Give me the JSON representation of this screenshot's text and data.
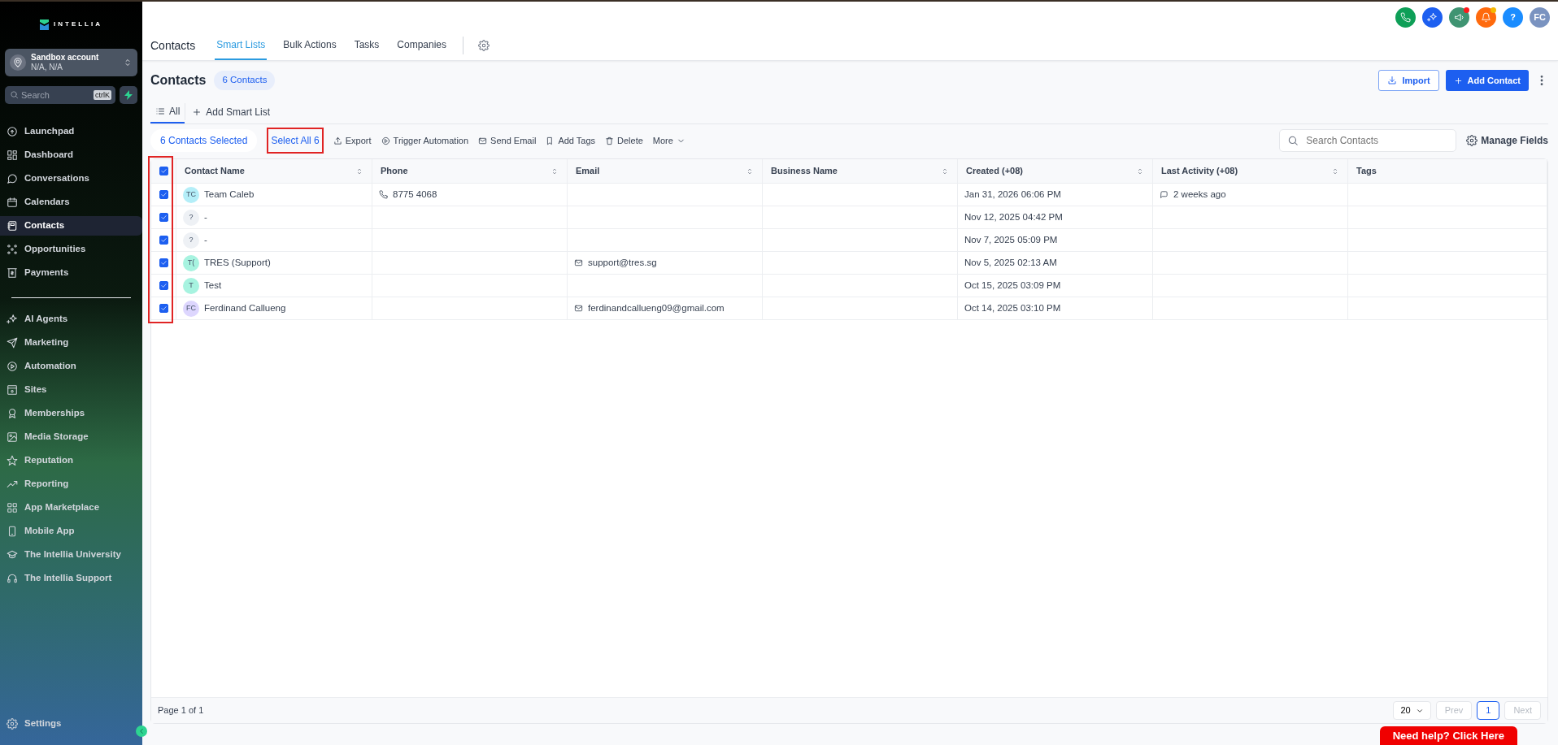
{
  "sidebar": {
    "logo": "INTELLIA",
    "account": {
      "name": "Sandbox account",
      "location": "N/A, N/A"
    },
    "search": {
      "placeholder": "Search",
      "shortcut": "ctrlK"
    },
    "main_items": [
      {
        "label": "Launchpad",
        "selected": false
      },
      {
        "label": "Dashboard",
        "selected": false
      },
      {
        "label": "Conversations",
        "selected": false
      },
      {
        "label": "Calendars",
        "selected": false
      },
      {
        "label": "Contacts",
        "selected": true
      },
      {
        "label": "Opportunities",
        "selected": false
      },
      {
        "label": "Payments",
        "selected": false
      }
    ],
    "more_items": [
      {
        "label": "AI Agents",
        "selected": false
      },
      {
        "label": "Marketing",
        "selected": false
      },
      {
        "label": "Automation",
        "selected": false
      },
      {
        "label": "Sites",
        "selected": false
      },
      {
        "label": "Memberships",
        "selected": false
      },
      {
        "label": "Media Storage",
        "selected": false
      },
      {
        "label": "Reputation",
        "selected": false
      },
      {
        "label": "Reporting",
        "selected": false
      },
      {
        "label": "App Marketplace",
        "selected": false
      },
      {
        "label": "Mobile App",
        "selected": false
      },
      {
        "label": "The Intellia University",
        "selected": false
      },
      {
        "label": "The Intellia Support",
        "selected": false
      }
    ],
    "settings": "Settings"
  },
  "header": {
    "title": "Contacts",
    "tabs": [
      {
        "label": "Smart Lists",
        "selected": true
      },
      {
        "label": "Bulk Actions",
        "selected": false
      },
      {
        "label": "Tasks",
        "selected": false
      },
      {
        "label": "Companies",
        "selected": false
      }
    ],
    "quick_actions": [
      {
        "kind": "phone",
        "color": "#0e9f57",
        "alert": false
      },
      {
        "kind": "sparkle",
        "color": "#1d5ff0",
        "alert": false
      },
      {
        "kind": "megaphone",
        "color": "#3f9472",
        "alert": true
      },
      {
        "kind": "bell",
        "color": "#ff6a0d",
        "alert": true
      },
      {
        "kind": "help",
        "color": "#1a8cff",
        "alert": false,
        "label": "?"
      },
      {
        "kind": "avatar",
        "color": "#7a93c0",
        "alert": false,
        "label": "FC"
      }
    ]
  },
  "page": {
    "title": "Contacts",
    "count": "6 Contacts",
    "import": "Import",
    "add": "Add Contact",
    "list_tabs": [
      {
        "label": "All",
        "selected": true
      }
    ],
    "add_list": "Add Smart List"
  },
  "bulk": {
    "selected_count": "6 Contacts Selected",
    "select_all": {
      "label": "Select All 6",
      "highlighted": true
    },
    "actions": [
      "Export",
      "Trigger Automation",
      "Send Email",
      "Add Tags",
      "Delete"
    ],
    "more": "More",
    "search": {
      "placeholder": "Search Contacts"
    },
    "manage_fields": "Manage Fields"
  },
  "table": {
    "all_checked": true,
    "checkbox_column_highlighted": true,
    "columns": [
      {
        "label": "Contact Name",
        "sortable": true
      },
      {
        "label": "Phone",
        "sortable": true
      },
      {
        "label": "Email",
        "sortable": true
      },
      {
        "label": "Business Name",
        "sortable": true
      },
      {
        "label": "Created (+08)",
        "sortable": true
      },
      {
        "label": "Last Activity (+08)",
        "sortable": true
      },
      {
        "label": "Tags",
        "sortable": false
      }
    ],
    "rows": [
      {
        "checked": true,
        "initials": "TC",
        "color": "#b4eef8",
        "name": "Team Caleb",
        "phone": "8775 4068",
        "created": "Jan 31, 2026 06:06 PM",
        "last_activity": "2 weeks ago"
      },
      {
        "checked": true,
        "initials": "?",
        "color": "#eef1f5",
        "name": "-",
        "created": "Nov 12, 2025 04:42 PM"
      },
      {
        "checked": true,
        "initials": "?",
        "color": "#eef1f5",
        "name": "-",
        "created": "Nov 7, 2025 05:09 PM"
      },
      {
        "checked": true,
        "initials": "T(",
        "color": "#a7f3e0",
        "name": "TRES (Support)",
        "email": "support@tres.sg",
        "created": "Nov 5, 2025 02:13 AM"
      },
      {
        "checked": true,
        "initials": "T",
        "color": "#a7f3e0",
        "name": "Test",
        "created": "Oct 15, 2025 03:09 PM"
      },
      {
        "checked": true,
        "initials": "FC",
        "color": "#ddd6fe",
        "name": "Ferdinand Callueng",
        "email": "ferdinandcallueng09@gmail.com",
        "created": "Oct 14, 2025 03:10 PM"
      }
    ]
  },
  "footer": {
    "page_info": "Page 1 of 1",
    "page_size": "20",
    "prev": {
      "label": "Prev",
      "disabled": true
    },
    "pages": [
      {
        "label": "1",
        "selected": true
      }
    ],
    "next": {
      "label": "Next",
      "disabled": true
    }
  },
  "help_button": "Need help? Click Here"
}
